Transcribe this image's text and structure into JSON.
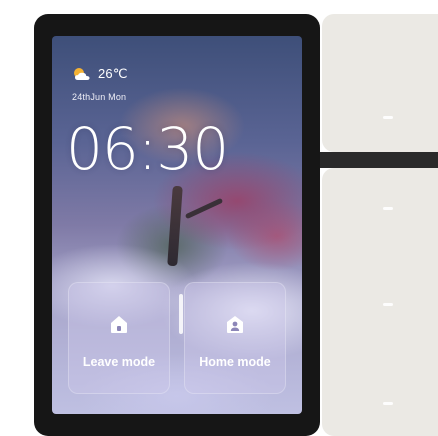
{
  "weather": {
    "icon": "partly-cloudy-icon",
    "temperature": "26℃",
    "date": "24thJun  Mon"
  },
  "clock": {
    "time": "06:30"
  },
  "modes": {
    "leave": {
      "label": "Leave mode",
      "icon": "house-icon"
    },
    "home": {
      "label": "Home mode",
      "icon": "user-lock-icon"
    }
  },
  "colors": {
    "bezel": "#161616",
    "switch_panel": "#ebe9e4",
    "sun": "#f5b233",
    "text": "#ffffff"
  }
}
